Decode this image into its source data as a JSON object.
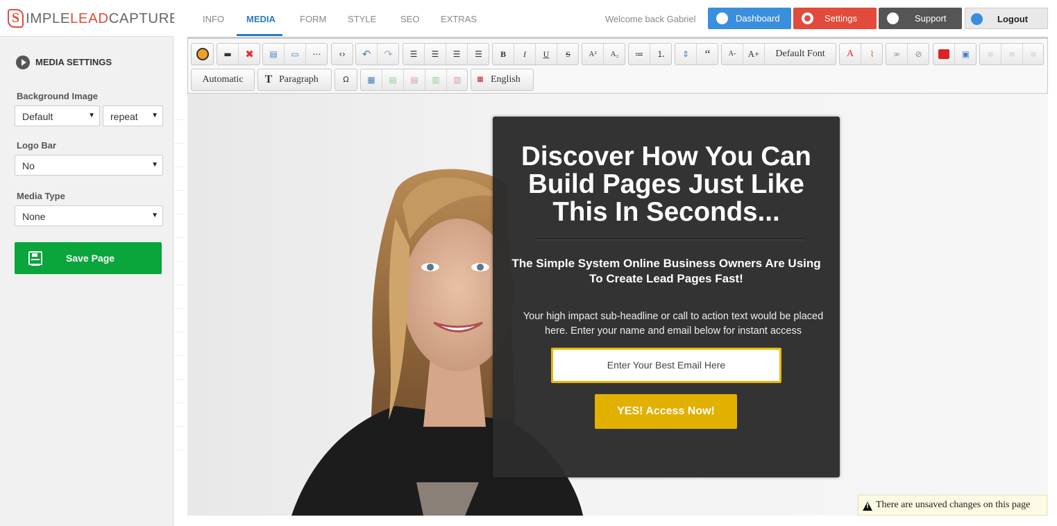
{
  "logo": {
    "prefix": "S",
    "part1": "IMPLE",
    "part2": "LEAD",
    "part3": "CAPTURE"
  },
  "sidebar": {
    "section_title": "MEDIA SETTINGS",
    "background_image": {
      "label": "Background Image",
      "value": "Default",
      "repeat": "repeat"
    },
    "logo_bar": {
      "label": "Logo Bar",
      "value": "No"
    },
    "media_type": {
      "label": "Media Type",
      "value": "None"
    },
    "save_label": "Save Page"
  },
  "tabs": [
    {
      "label": "INFO",
      "active": false
    },
    {
      "label": "MEDIA",
      "active": true
    },
    {
      "label": "FORM",
      "active": false
    },
    {
      "label": "STYLE",
      "active": false
    },
    {
      "label": "SEO",
      "active": false
    },
    {
      "label": "EXTRAS",
      "active": false
    }
  ],
  "header": {
    "welcome": "Welcome back Gabriel",
    "dashboard": "Dashboard",
    "settings": "Settings",
    "support": "Support",
    "logout": "Logout"
  },
  "toolbar": {
    "bold": "B",
    "italic": "I",
    "underline": "U",
    "strike": "S",
    "superscript": "A²",
    "subscript": "A₂",
    "quote": "“",
    "font_smaller": "A-",
    "font_larger": "A+",
    "font": "Default Font",
    "format_auto": "Automatic",
    "format_block": "Paragraph",
    "omega": "Ω",
    "language": "English"
  },
  "preview": {
    "headline": "Discover How You Can Build Pages Just Like This In Seconds...",
    "subheadline": "The Simple System Online Business Owners Are Using To Create Lead Pages Fast!",
    "body": "Your high impact sub-headline or call to action text would be placed here. Enter your name and email below for instant access",
    "email_placeholder": "Enter Your Best Email Here",
    "cta": "YES! Access Now!"
  },
  "notice": "There are unsaved changes on this page",
  "colors": {
    "accent": "#2a7ac0",
    "save": "#0aa53b",
    "settings": "#e24a3b",
    "cta": "#e2b000",
    "dashboard": "#3a8ede",
    "support": "#555555"
  }
}
